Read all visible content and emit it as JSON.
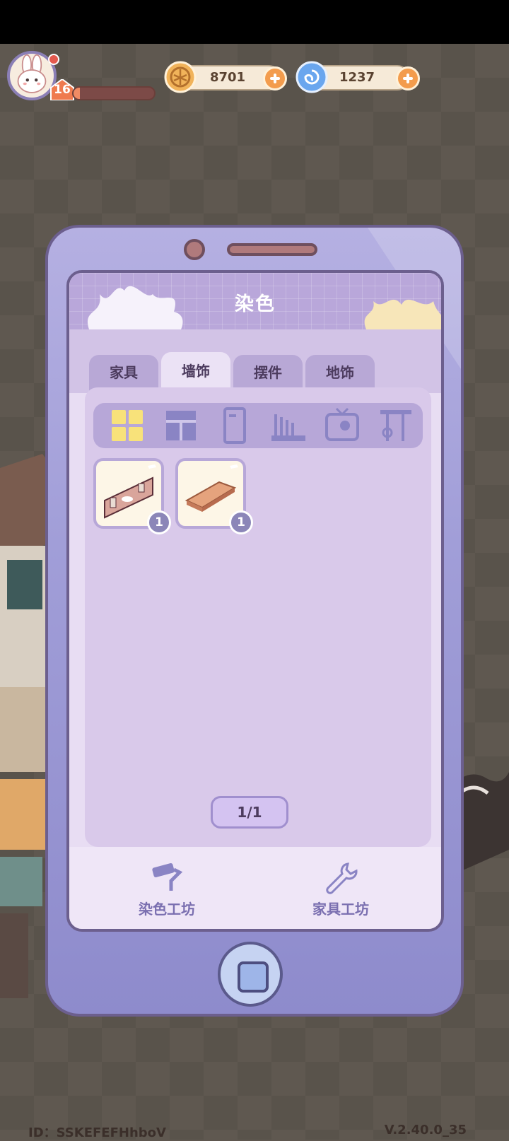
{
  "hud": {
    "level": "16",
    "xp_progress": 0.08,
    "coins": "8701",
    "gems": "1237"
  },
  "phone": {
    "title": "染色",
    "tabs": [
      {
        "label": "家具"
      },
      {
        "label": "墙饰"
      },
      {
        "label": "摆件"
      },
      {
        "label": "地饰"
      }
    ],
    "active_tab": 1,
    "categories": [
      "grid-icon",
      "window-icon",
      "door-icon",
      "rack-icon",
      "frame-icon",
      "utensil-icon"
    ],
    "items": [
      {
        "name": "wall-shelf",
        "count": "1"
      },
      {
        "name": "wall-plank",
        "count": "1"
      }
    ],
    "pager": "1/1",
    "workshops": {
      "dye": "染色工坊",
      "furniture": "家具工坊"
    }
  },
  "footer": {
    "id": "ID：SSKEFEFHhboV",
    "version": "V.2.40.0_35"
  },
  "colors": {
    "phone_body": "#a19ed8",
    "screen_bg": "#e8ddf3",
    "accent": "#f39c4d",
    "text": "#4c3b5e"
  }
}
